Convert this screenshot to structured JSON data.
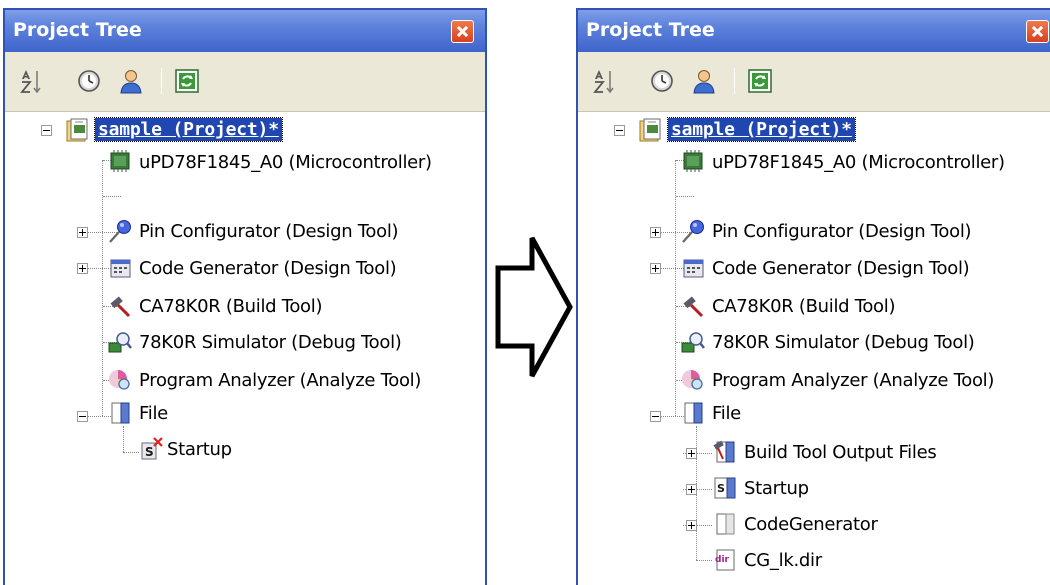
{
  "left_panel": {
    "title": "Project Tree",
    "tree": {
      "root": "sample (Project)*",
      "items": [
        "uPD78F1845_A0 (Microcontroller)",
        "Pin Configurator (Design Tool)",
        "Code Generator (Design Tool)",
        "CA78K0R (Build Tool)",
        "78K0R Simulator (Debug Tool)",
        "Program Analyzer (Analyze Tool)",
        "File"
      ],
      "file_children": [
        "Startup"
      ]
    }
  },
  "right_panel": {
    "title": "Project Tree",
    "tree": {
      "root": "sample (Project)*",
      "items": [
        "uPD78F1845_A0 (Microcontroller)",
        "Pin Configurator (Design Tool)",
        "Code Generator (Design Tool)",
        "CA78K0R (Build Tool)",
        "78K0R Simulator (Debug Tool)",
        "Program Analyzer (Analyze Tool)",
        "File"
      ],
      "file_children": [
        "Build Tool Output Files",
        "Startup",
        "CodeGenerator",
        "CG_lk.dir"
      ]
    }
  },
  "toolbar_icons": [
    "sort-az-icon",
    "clock-icon",
    "person-icon",
    "refresh-icon"
  ],
  "colors": {
    "title_bar": "#3f64cb",
    "selection": "#2046b0",
    "toolbar_bg": "#ece8d8",
    "close_button": "#d9411d"
  }
}
